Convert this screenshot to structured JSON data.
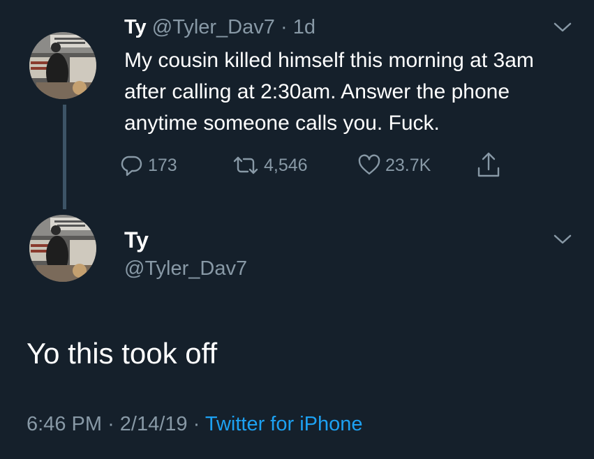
{
  "tweet1": {
    "name": "Ty",
    "handle": "@Tyler_Dav7",
    "dot": "·",
    "time": "1d",
    "text": "My cousin killed himself this morning at 3am after calling at 2:30am. Answer the phone anytime someone calls you. Fuck.",
    "actions": {
      "replies": "173",
      "retweets": "4,546",
      "likes": "23.7K"
    },
    "icons": [
      "reply-icon",
      "retweet-icon",
      "like-icon",
      "share-icon",
      "chevron-down-icon"
    ]
  },
  "tweet2": {
    "name": "Ty",
    "handle": "@Tyler_Dav7",
    "text": "Yo this took off",
    "meta": {
      "time": "6:46 PM",
      "sep1": "·",
      "date": "2/14/19",
      "sep2": "·",
      "source": "Twitter for iPhone"
    }
  },
  "colors": {
    "background": "#15202b",
    "text": "#ffffff",
    "muted": "#8899a6",
    "link": "#1da1f2",
    "thread_line": "#3d5466"
  }
}
